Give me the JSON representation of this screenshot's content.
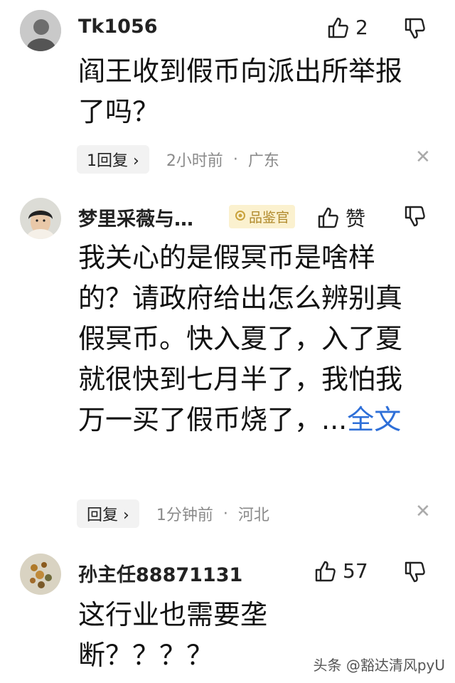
{
  "comments": [
    {
      "username": "Tk1056",
      "text": "阎王收到假币向派出所举报了吗？",
      "like_count": "2",
      "reply_label": "1回复",
      "reply_chevron": "›",
      "time": "2小时前",
      "separator": "·",
      "location": "广东",
      "close": "✕"
    },
    {
      "username": "梦里采薇与…",
      "badge": "品鉴官",
      "text": "我关心的是假冥币是啥样的？请政府给出怎么辨别真假冥币。快入夏了，入了夏就很快到七月半了，我怕我万一买了假币烧了，...",
      "full_text_link": "全文",
      "like_label": "赞",
      "reply_label": "回复",
      "reply_chevron": "›",
      "time": "1分钟前",
      "separator": "·",
      "location": "河北",
      "close": "✕"
    },
    {
      "username": "孙主任88871131",
      "text": "这行业也需要垄断？？？？",
      "like_count": "57"
    }
  ],
  "watermark": "头条 @豁达清风pyU",
  "icons": {
    "like": "thumbs-up-icon",
    "dislike": "thumbs-down-icon",
    "badge": "medal-icon",
    "close": "close-icon"
  },
  "colors": {
    "link": "#2e6fd8",
    "badge_bg": "#fbf1cf",
    "badge_text": "#b08a2c",
    "meta": "#8a8a8a"
  }
}
